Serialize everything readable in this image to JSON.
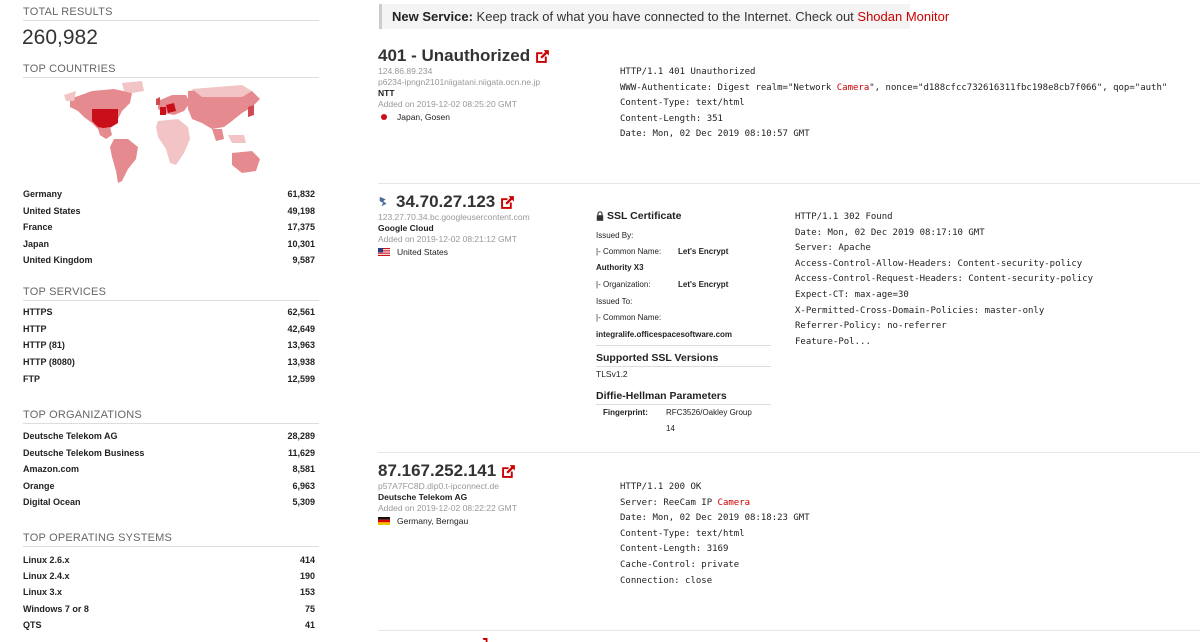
{
  "sidebar": {
    "total_results_label": "TOTAL RESULTS",
    "total_results_value": "260,982",
    "top_countries": {
      "title": "TOP COUNTRIES",
      "items": [
        {
          "label": "Germany",
          "count": "61,832"
        },
        {
          "label": "United States",
          "count": "49,198"
        },
        {
          "label": "France",
          "count": "17,375"
        },
        {
          "label": "Japan",
          "count": "10,301"
        },
        {
          "label": "United Kingdom",
          "count": "9,587"
        }
      ]
    },
    "top_services": {
      "title": "TOP SERVICES",
      "items": [
        {
          "label": "HTTPS",
          "count": "62,561"
        },
        {
          "label": "HTTP",
          "count": "42,649"
        },
        {
          "label": "HTTP (81)",
          "count": "13,963"
        },
        {
          "label": "HTTP (8080)",
          "count": "13,938"
        },
        {
          "label": "FTP",
          "count": "12,599"
        }
      ]
    },
    "top_organizations": {
      "title": "TOP ORGANIZATIONS",
      "items": [
        {
          "label": "Deutsche Telekom AG",
          "count": "28,289"
        },
        {
          "label": "Deutsche Telekom Business",
          "count": "11,629"
        },
        {
          "label": "Amazon.com",
          "count": "8,581"
        },
        {
          "label": "Orange",
          "count": "6,963"
        },
        {
          "label": "Digital Ocean",
          "count": "5,309"
        }
      ]
    },
    "top_os": {
      "title": "TOP OPERATING SYSTEMS",
      "items": [
        {
          "label": "Linux 2.6.x",
          "count": "414"
        },
        {
          "label": "Linux 2.4.x",
          "count": "190"
        },
        {
          "label": "Linux 3.x",
          "count": "153"
        },
        {
          "label": "Windows 7 or 8",
          "count": "75"
        },
        {
          "label": "QTS",
          "count": "41"
        }
      ]
    }
  },
  "banner": {
    "prefix": "New Service:",
    "text": " Keep track of what you have connected to the Internet. Check out ",
    "link": "Shodan Monitor"
  },
  "results": [
    {
      "title": "401 - Unauthorized",
      "ip": "124.86.89.234",
      "hostname": "p6234-ipngn2101niigatani.niigata.ocn.ne.jp",
      "org": "NTT",
      "added": "Added on 2019-12-02 08:25:20 GMT",
      "location": "Japan,  Gosen",
      "banner_lines": [
        "HTTP/1.1 401 Unauthorized",
        "WWW-Authenticate: Digest realm=\"Network ",
        "Camera",
        "\", nonce=\"d188cfcc732616311fbc198e8cb7f066\", qop=\"auth\"",
        "Content-Type: text/html",
        "Content-Length: 351",
        "Date: Mon, 02 Dec 2019 08:10:57 GMT"
      ]
    },
    {
      "title": "34.70.27.123",
      "hostname": "123.27.70.34.bc.googleusercontent.com",
      "org": "Google Cloud",
      "added": "Added on 2019-12-02 08:21:12 GMT",
      "location": "United States",
      "ssl": {
        "heading": "SSL Certificate",
        "issued_by": "Issued By:",
        "cn_label": "|- Common Name:",
        "cn_value": "Let's Encrypt",
        "cn_value2": "Authority X3",
        "org_label": "|- Organization:",
        "org_value": "Let's Encrypt",
        "issued_to": "Issued To:",
        "to_cn_label": "|- Common Name:",
        "to_cn_value": "integralife.officespacesoftware.com",
        "versions_heading": "Supported SSL Versions",
        "versions_value": "TLSv1.2",
        "dh_heading": "Diffie-Hellman Parameters",
        "fp_label": "Fingerprint:",
        "fp_value": "RFC3526/Oakley Group",
        "fp_value2": "14"
      },
      "banner_lines": [
        "HTTP/1.1 302 Found",
        "Date: Mon, 02 Dec 2019 08:17:10 GMT",
        "Server: Apache",
        "Access-Control-Allow-Headers: Content-security-policy",
        "Access-Control-Request-Headers: Content-security-policy",
        "Expect-CT: max-age=30",
        "X-Permitted-Cross-Domain-Policies: master-only",
        "Referrer-Policy: no-referrer",
        "Feature-Pol..."
      ]
    },
    {
      "title": "87.167.252.141",
      "hostname": "p57A7FC8D.dip0.t-ipconnect.de",
      "org": "Deutsche Telekom AG",
      "added": "Added on 2019-12-02 08:22:22 GMT",
      "location": "Germany,  Berngau",
      "banner_lines": [
        "HTTP/1.1 200 OK",
        "Server: ReeCam IP ",
        "Camera",
        "Date: Mon, 02 Dec 2019 08:18:23 GMT",
        "Content-Type: text/html",
        "Content-Length: 3169",
        "Cache-Control: private",
        "Connection: close"
      ]
    }
  ],
  "colors": {
    "accent": "#cc0000",
    "map_dark": "#c9101a",
    "map_mid": "#e07a7f",
    "map_light": "#f2c4c6"
  },
  "icons": [
    "external-link-icon",
    "lock-icon",
    "globe-icon",
    "flag-japan-icon",
    "flag-us-icon",
    "flag-germany-icon"
  ]
}
